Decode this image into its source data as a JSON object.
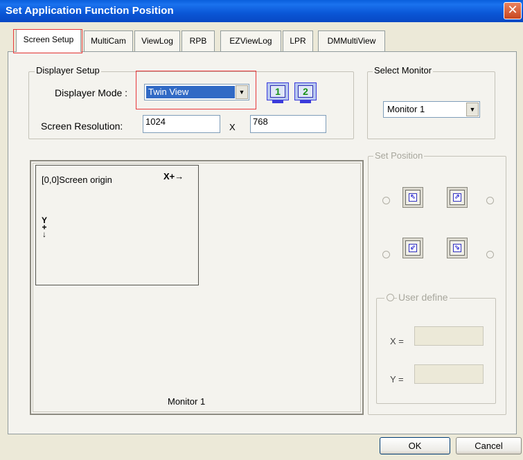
{
  "window": {
    "title": "Set Application Function Position",
    "close_glyph": "✕"
  },
  "tabs": [
    {
      "label": "Screen Setup",
      "active": true
    },
    {
      "label": "MultiCam"
    },
    {
      "label": "ViewLog"
    },
    {
      "label": "RPB"
    },
    {
      "label": "EZViewLog"
    },
    {
      "label": "LPR"
    },
    {
      "label": "DMMultiView"
    }
  ],
  "displayer_setup": {
    "group_label": "Displayer Setup",
    "mode_label": "Displayer Mode :",
    "mode_value": "Twin View",
    "resolution_label": "Screen Resolution:",
    "width": "1024",
    "times": "X",
    "height": "768",
    "monitor_icons": [
      "1",
      "2"
    ]
  },
  "select_monitor": {
    "group_label": "Select Monitor",
    "value": "Monitor 1"
  },
  "preview": {
    "origin_label": "[0,0]Screen origin",
    "x_axis": "X+→",
    "y_axis": [
      "Y",
      "+",
      "↓"
    ],
    "monitor_label": "Monitor 1"
  },
  "set_position": {
    "group_label": "Set Position",
    "icons": [
      "arrow-up-left-icon",
      "arrow-up-right-icon",
      "arrow-down-left-icon",
      "arrow-down-right-icon"
    ],
    "icon_glyphs": [
      "⇖",
      "⇗",
      "⇙",
      "⇘"
    ],
    "user_define_label": "User define",
    "x_label": "X =",
    "y_label": "Y =",
    "x_value": "",
    "y_value": ""
  },
  "buttons": {
    "ok": "OK",
    "cancel": "Cancel"
  },
  "colors": {
    "titlebar": "#0a56d6",
    "highlight": "#e8373a",
    "selection": "#316ac5",
    "monitor_digit": "#189218"
  }
}
